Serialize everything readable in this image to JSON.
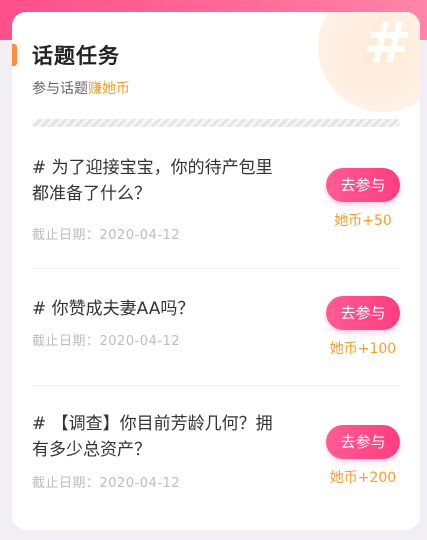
{
  "header": {
    "title": "话题任务",
    "subtitle_prefix": "参与话题",
    "subtitle_highlight": "赚她币"
  },
  "topics": [
    {
      "title_line1": "# 为了迎接宝宝，你的待产包里",
      "title_line2": "都准备了什么？",
      "deadline": "截止日期：2020-04-12",
      "button": "去参与",
      "reward": "她币+50"
    },
    {
      "title_line1": "# 你赞成夫妻AA吗？",
      "title_line2": "",
      "deadline": "截止日期：2020-04-12",
      "button": "去参与",
      "reward": "她币+100"
    },
    {
      "title_line1": "# 【调查】你目前芳龄几何？拥",
      "title_line2": "有多少总资产？",
      "deadline": "截止日期：2020-04-12",
      "button": "去参与",
      "reward": "她币+200"
    }
  ],
  "colors": {
    "accent": "#ff8a3d",
    "button": "#ff4f8b",
    "reward": "#ff9a2e"
  }
}
